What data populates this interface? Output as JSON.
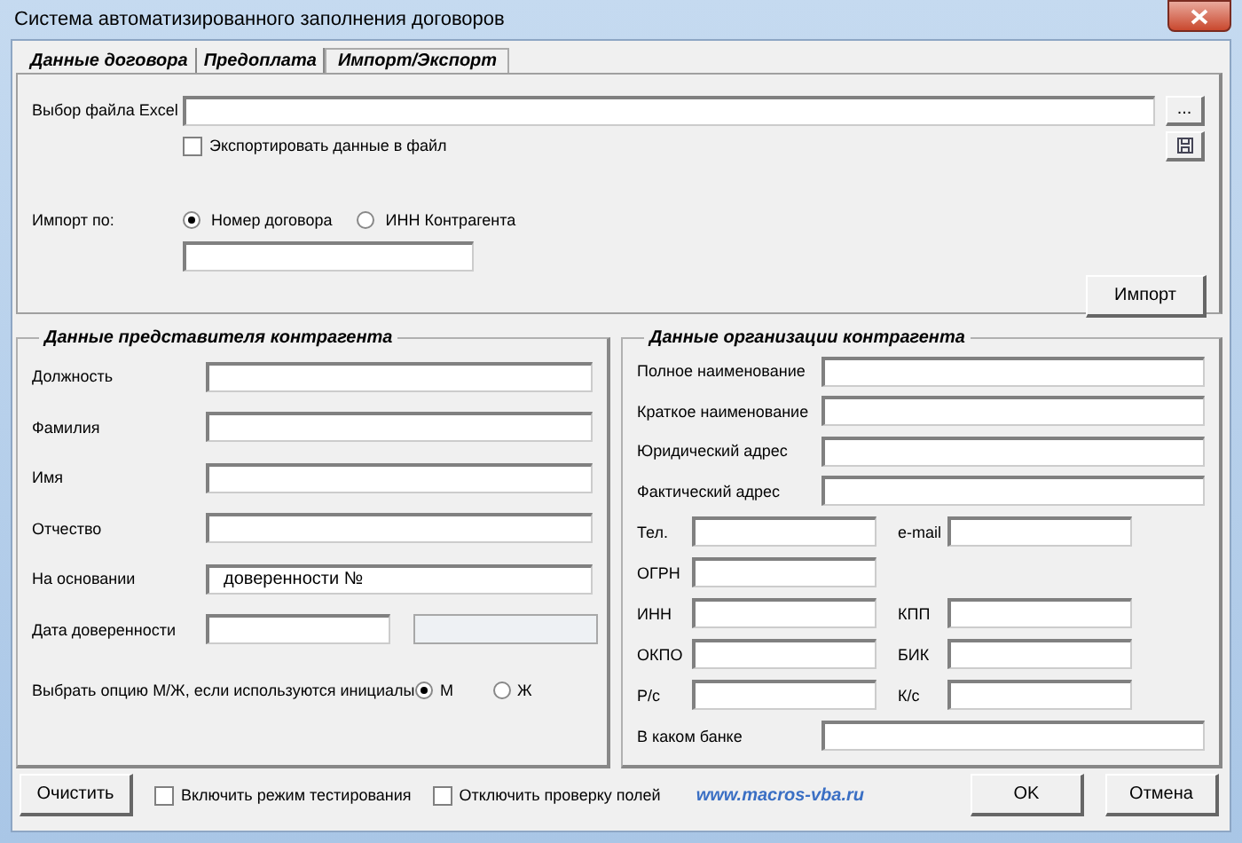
{
  "window": {
    "title": "Система автоматизированного заполнения договоров"
  },
  "tabs": [
    {
      "label": "Данные договора",
      "selected": false
    },
    {
      "label": "Предоплата",
      "selected": false
    },
    {
      "label": "Импорт/Экспорт",
      "selected": true
    }
  ],
  "import_export": {
    "file_label": "Выбор файла Excel",
    "browse_button": "...",
    "export_checkbox": {
      "label": "Экспортировать данные в файл",
      "checked": false
    },
    "import_by_label": "Импорт по:",
    "import_options": [
      {
        "label": "Номер договора",
        "selected": true
      },
      {
        "label": "ИНН Контрагента",
        "selected": false
      }
    ],
    "import_button": "Импорт"
  },
  "representative": {
    "title": "Данные представителя контрагента",
    "fields": [
      {
        "label": "Должность"
      },
      {
        "label": "Фамилия"
      },
      {
        "label": "Имя"
      },
      {
        "label": "Отчество"
      },
      {
        "label": "На основании",
        "value": "доверенности №"
      }
    ],
    "date_label": "Дата доверенности",
    "date_fields": [
      {
        "disabled": false
      },
      {
        "disabled": true
      }
    ],
    "gender_label": "Выбрать опцию М/Ж, если используются инициалы",
    "gender_options": [
      {
        "label": "М",
        "selected": true
      },
      {
        "label": "Ж",
        "selected": false
      }
    ]
  },
  "organization": {
    "title": "Данные организации контрагента",
    "fields": [
      {
        "label": "Полное наименование"
      },
      {
        "label": "Краткое наименование"
      },
      {
        "label": "Юридический адрес"
      },
      {
        "label": "Фактический адрес"
      }
    ],
    "pairs": [
      [
        {
          "label": "Тел."
        },
        {
          "label": "e-mail"
        }
      ],
      [
        {
          "label": "ОГРН"
        }
      ],
      [
        {
          "label": "ИНН"
        },
        {
          "label": "КПП"
        }
      ],
      [
        {
          "label": "ОКПО"
        },
        {
          "label": "БИК"
        }
      ],
      [
        {
          "label": "Р/с"
        },
        {
          "label": "К/с"
        }
      ]
    ],
    "bank_label": "В каком банке"
  },
  "footer": {
    "clear_button": "Очистить",
    "checkboxes": [
      {
        "label": "Включить режим тестирования",
        "checked": false
      },
      {
        "label": "Отключить проверку полей",
        "checked": false
      }
    ],
    "link": "www.macros-vba.ru",
    "ok_button": "OK",
    "cancel_button": "Отмена"
  }
}
